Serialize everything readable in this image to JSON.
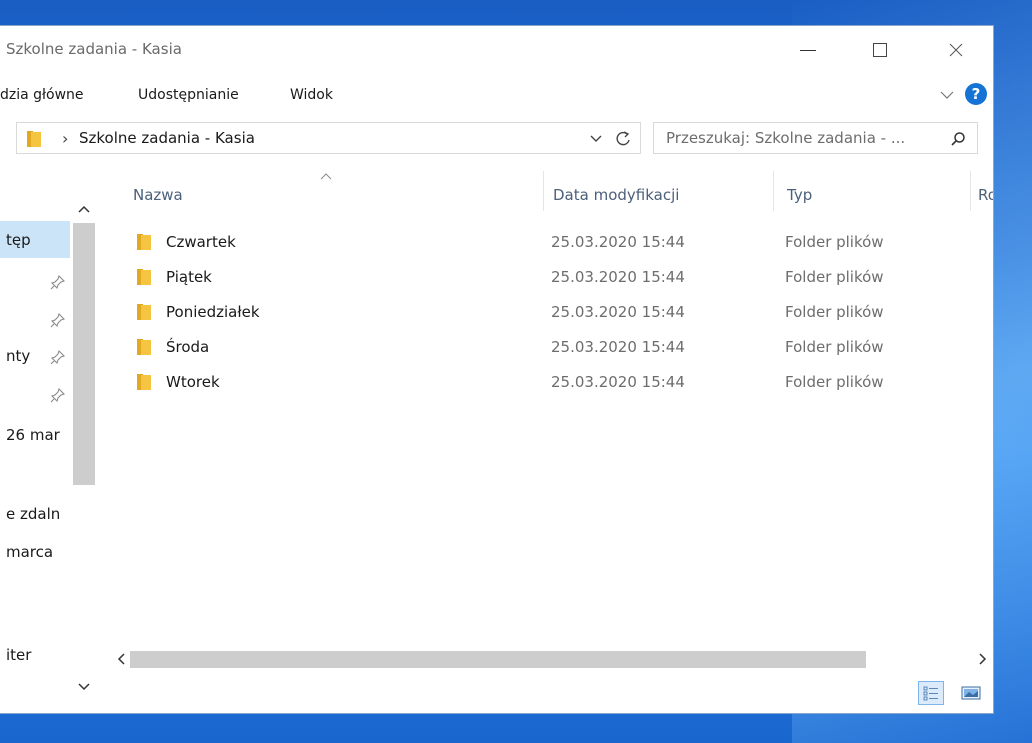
{
  "window": {
    "title": "Szkolne zadania - Kasia"
  },
  "ribbon": {
    "tabs": [
      "​dzia główne",
      "Udostępnianie",
      "Widok"
    ],
    "help_label": "?"
  },
  "address": {
    "path": "Szkolne zadania - Kasia"
  },
  "search": {
    "placeholder": "Przeszukaj: Szkolne zadania - ..."
  },
  "nav": {
    "items": [
      "tęp",
      "nty",
      "26 mar",
      "e zdaln",
      "marca",
      "iter"
    ]
  },
  "columns": {
    "name": "Nazwa",
    "date": "Data modyfikacji",
    "type": "Typ",
    "size": "Ro"
  },
  "files": [
    {
      "name": "Czwartek",
      "date": "25.03.2020 15:44",
      "type": "Folder plików"
    },
    {
      "name": "Piątek",
      "date": "25.03.2020 15:44",
      "type": "Folder plików"
    },
    {
      "name": "Poniedziałek",
      "date": "25.03.2020 15:44",
      "type": "Folder plików"
    },
    {
      "name": "Środa",
      "date": "25.03.2020 15:44",
      "type": "Folder plików"
    },
    {
      "name": "Wtorek",
      "date": "25.03.2020 15:44",
      "type": "Folder plików"
    }
  ],
  "colors": {
    "accent": "#1673d6",
    "selection": "#cce4f7",
    "folder": "#f5c542"
  },
  "icons": {
    "folder": "folder-icon",
    "pin": "pin-icon",
    "search": "search-icon",
    "refresh": "refresh-icon",
    "help": "help-icon"
  }
}
